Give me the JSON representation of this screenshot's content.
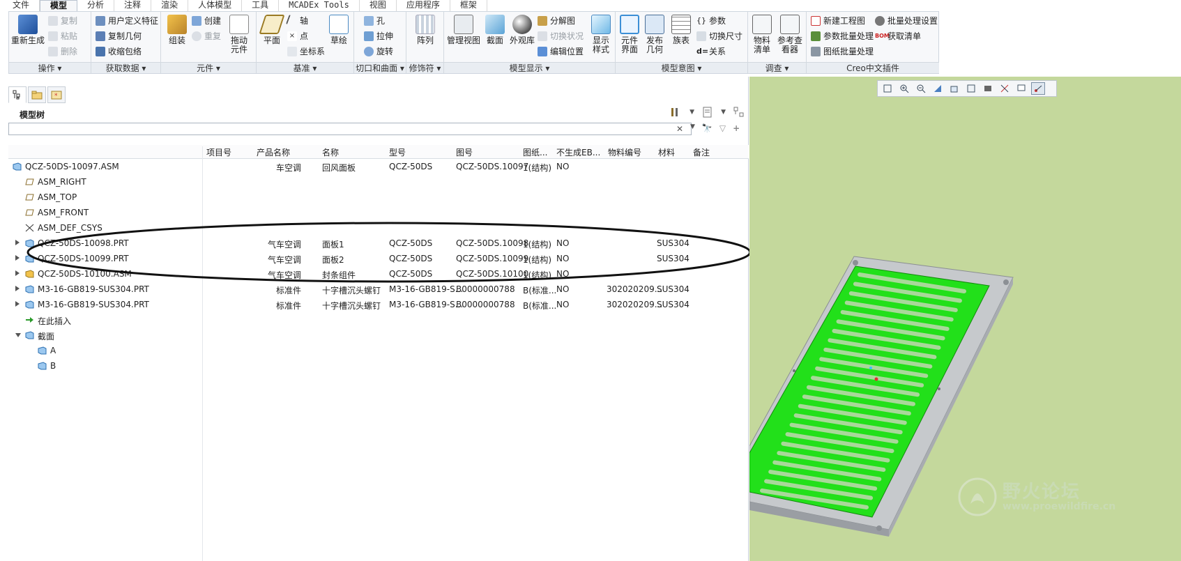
{
  "menu": {
    "tabs": [
      "文件",
      "模型",
      "分析",
      "注释",
      "渲染",
      "人体模型",
      "工具",
      "MCADEx Tools",
      "视图",
      "应用程序",
      "框架"
    ],
    "active": "模型"
  },
  "ribbon": {
    "groups": {
      "operation": "操作",
      "get_data": "获取数据",
      "component": "元件",
      "datum": "基准",
      "cut_surface": "切口和曲面",
      "modifier": "修饰符",
      "model_display": "模型显示",
      "model_intent": "模型意图",
      "investigate": "调查",
      "creo_plugin": "Creo中文插件"
    },
    "buttons": {
      "regenerate": "重新生成",
      "copy": "复制",
      "paste": "粘贴",
      "delete": "删除",
      "user_feature": "用户定义特征",
      "copy_geometry": "复制几何",
      "shrinkwrap": "收缩包络",
      "assemble": "组装",
      "create": "创建",
      "repeat": "重复",
      "drag": "拖动元件",
      "plane": "平面",
      "axis": "轴",
      "point": "点",
      "csys": "坐标系",
      "sketch": "草绘",
      "hole": "孔",
      "extrude": "拉伸",
      "revolve": "旋转",
      "pattern": "阵列",
      "manage_views": "管理视图",
      "section": "截面",
      "appearance": "外观库",
      "exploded": "分解图",
      "toggle_status": "切换状况",
      "edit_position": "编辑位置",
      "display_style": "显示样式",
      "component_interface": "元件界面",
      "publish_geom": "发布几何",
      "family_table": "族表",
      "parameters": "参数",
      "switch_dims": "切换尺寸",
      "relations": "关系",
      "bom": "物料清单",
      "ref_viewer": "参考查看器",
      "new_drawing": "新建工程图",
      "param_batch": "参数批量处理",
      "drawing_batch": "图纸批量处理",
      "batch_settings": "批量处理设置",
      "get_list": "获取清单",
      "bom_tag": "BOM"
    }
  },
  "tree": {
    "title": "模型树",
    "columns": [
      "项目号",
      "产品名称",
      "名称",
      "型号",
      "图号",
      "图纸...",
      "不生成EB...",
      "物料编号",
      "材料",
      "备注"
    ],
    "rows": [
      {
        "name": "QCZ-50DS-10097.ASM",
        "product": "车空调",
        "title": "回风面板",
        "model": "QCZ-50DS",
        "drawing": "QCZ-50DS.10097",
        "sheet": "1(结构)",
        "noeb": "NO",
        "material_no": "",
        "material": ""
      },
      {
        "name": "ASM_RIGHT",
        "product": "",
        "title": "",
        "model": "",
        "drawing": "",
        "sheet": "",
        "noeb": "",
        "material_no": "",
        "material": ""
      },
      {
        "name": "ASM_TOP",
        "product": "",
        "title": "",
        "model": "",
        "drawing": "",
        "sheet": "",
        "noeb": "",
        "material_no": "",
        "material": ""
      },
      {
        "name": "ASM_FRONT",
        "product": "",
        "title": "",
        "model": "",
        "drawing": "",
        "sheet": "",
        "noeb": "",
        "material_no": "",
        "material": ""
      },
      {
        "name": "ASM_DEF_CSYS",
        "product": "",
        "title": "",
        "model": "",
        "drawing": "",
        "sheet": "",
        "noeb": "",
        "material_no": "",
        "material": ""
      },
      {
        "name": "QCZ-50DS-10098.PRT",
        "product": "气车空调",
        "title": "面板1",
        "model": "QCZ-50DS",
        "drawing": "QCZ-50DS.10098",
        "sheet": "1(结构)",
        "noeb": "NO",
        "material_no": "",
        "material": "SUS304"
      },
      {
        "name": "QCZ-50DS-10099.PRT",
        "product": "气车空调",
        "title": "面板2",
        "model": "QCZ-50DS",
        "drawing": "QCZ-50DS.10099",
        "sheet": "1(结构)",
        "noeb": "NO",
        "material_no": "",
        "material": "SUS304"
      },
      {
        "name": "QCZ-50DS-10100.ASM",
        "product": "气车空调",
        "title": "封条组件",
        "model": "QCZ-50DS",
        "drawing": "QCZ-50DS.10100",
        "sheet": "1(结构)",
        "noeb": "NO",
        "material_no": "",
        "material": ""
      },
      {
        "name": "M3-16-GB819-SUS304.PRT",
        "product": "标准件",
        "title": "十字槽沉头螺钉",
        "model": "M3-16-GB819-S...",
        "drawing": "B0000000788",
        "sheet": "B(标准...",
        "noeb": "NO",
        "material_no": "302020209...",
        "material": "SUS304"
      },
      {
        "name": "M3-16-GB819-SUS304.PRT",
        "product": "标准件",
        "title": "十字槽沉头螺钉",
        "model": "M3-16-GB819-S...",
        "drawing": "B0000000788",
        "sheet": "B(标准...",
        "noeb": "NO",
        "material_no": "302020209...",
        "material": "SUS304"
      },
      {
        "name": "在此插入",
        "product": "",
        "title": "",
        "model": "",
        "drawing": "",
        "sheet": "",
        "noeb": "",
        "material_no": "",
        "material": ""
      },
      {
        "name": "截面",
        "product": "",
        "title": "",
        "model": "",
        "drawing": "",
        "sheet": "",
        "noeb": "",
        "material_no": "",
        "material": ""
      },
      {
        "name": "A",
        "product": "",
        "title": "",
        "model": "",
        "drawing": "",
        "sheet": "",
        "noeb": "",
        "material_no": "",
        "material": ""
      },
      {
        "name": "B",
        "product": "",
        "title": "",
        "model": "",
        "drawing": "",
        "sheet": "",
        "noeb": "",
        "material_no": "",
        "material": ""
      }
    ]
  },
  "watermark": {
    "title": "野火论坛",
    "url": "www.proewildfire.cn"
  },
  "colors": {
    "viewport_bg": "#c4d89c",
    "part_green": "#22e01a",
    "frame_gray": "#bfc3c7"
  }
}
